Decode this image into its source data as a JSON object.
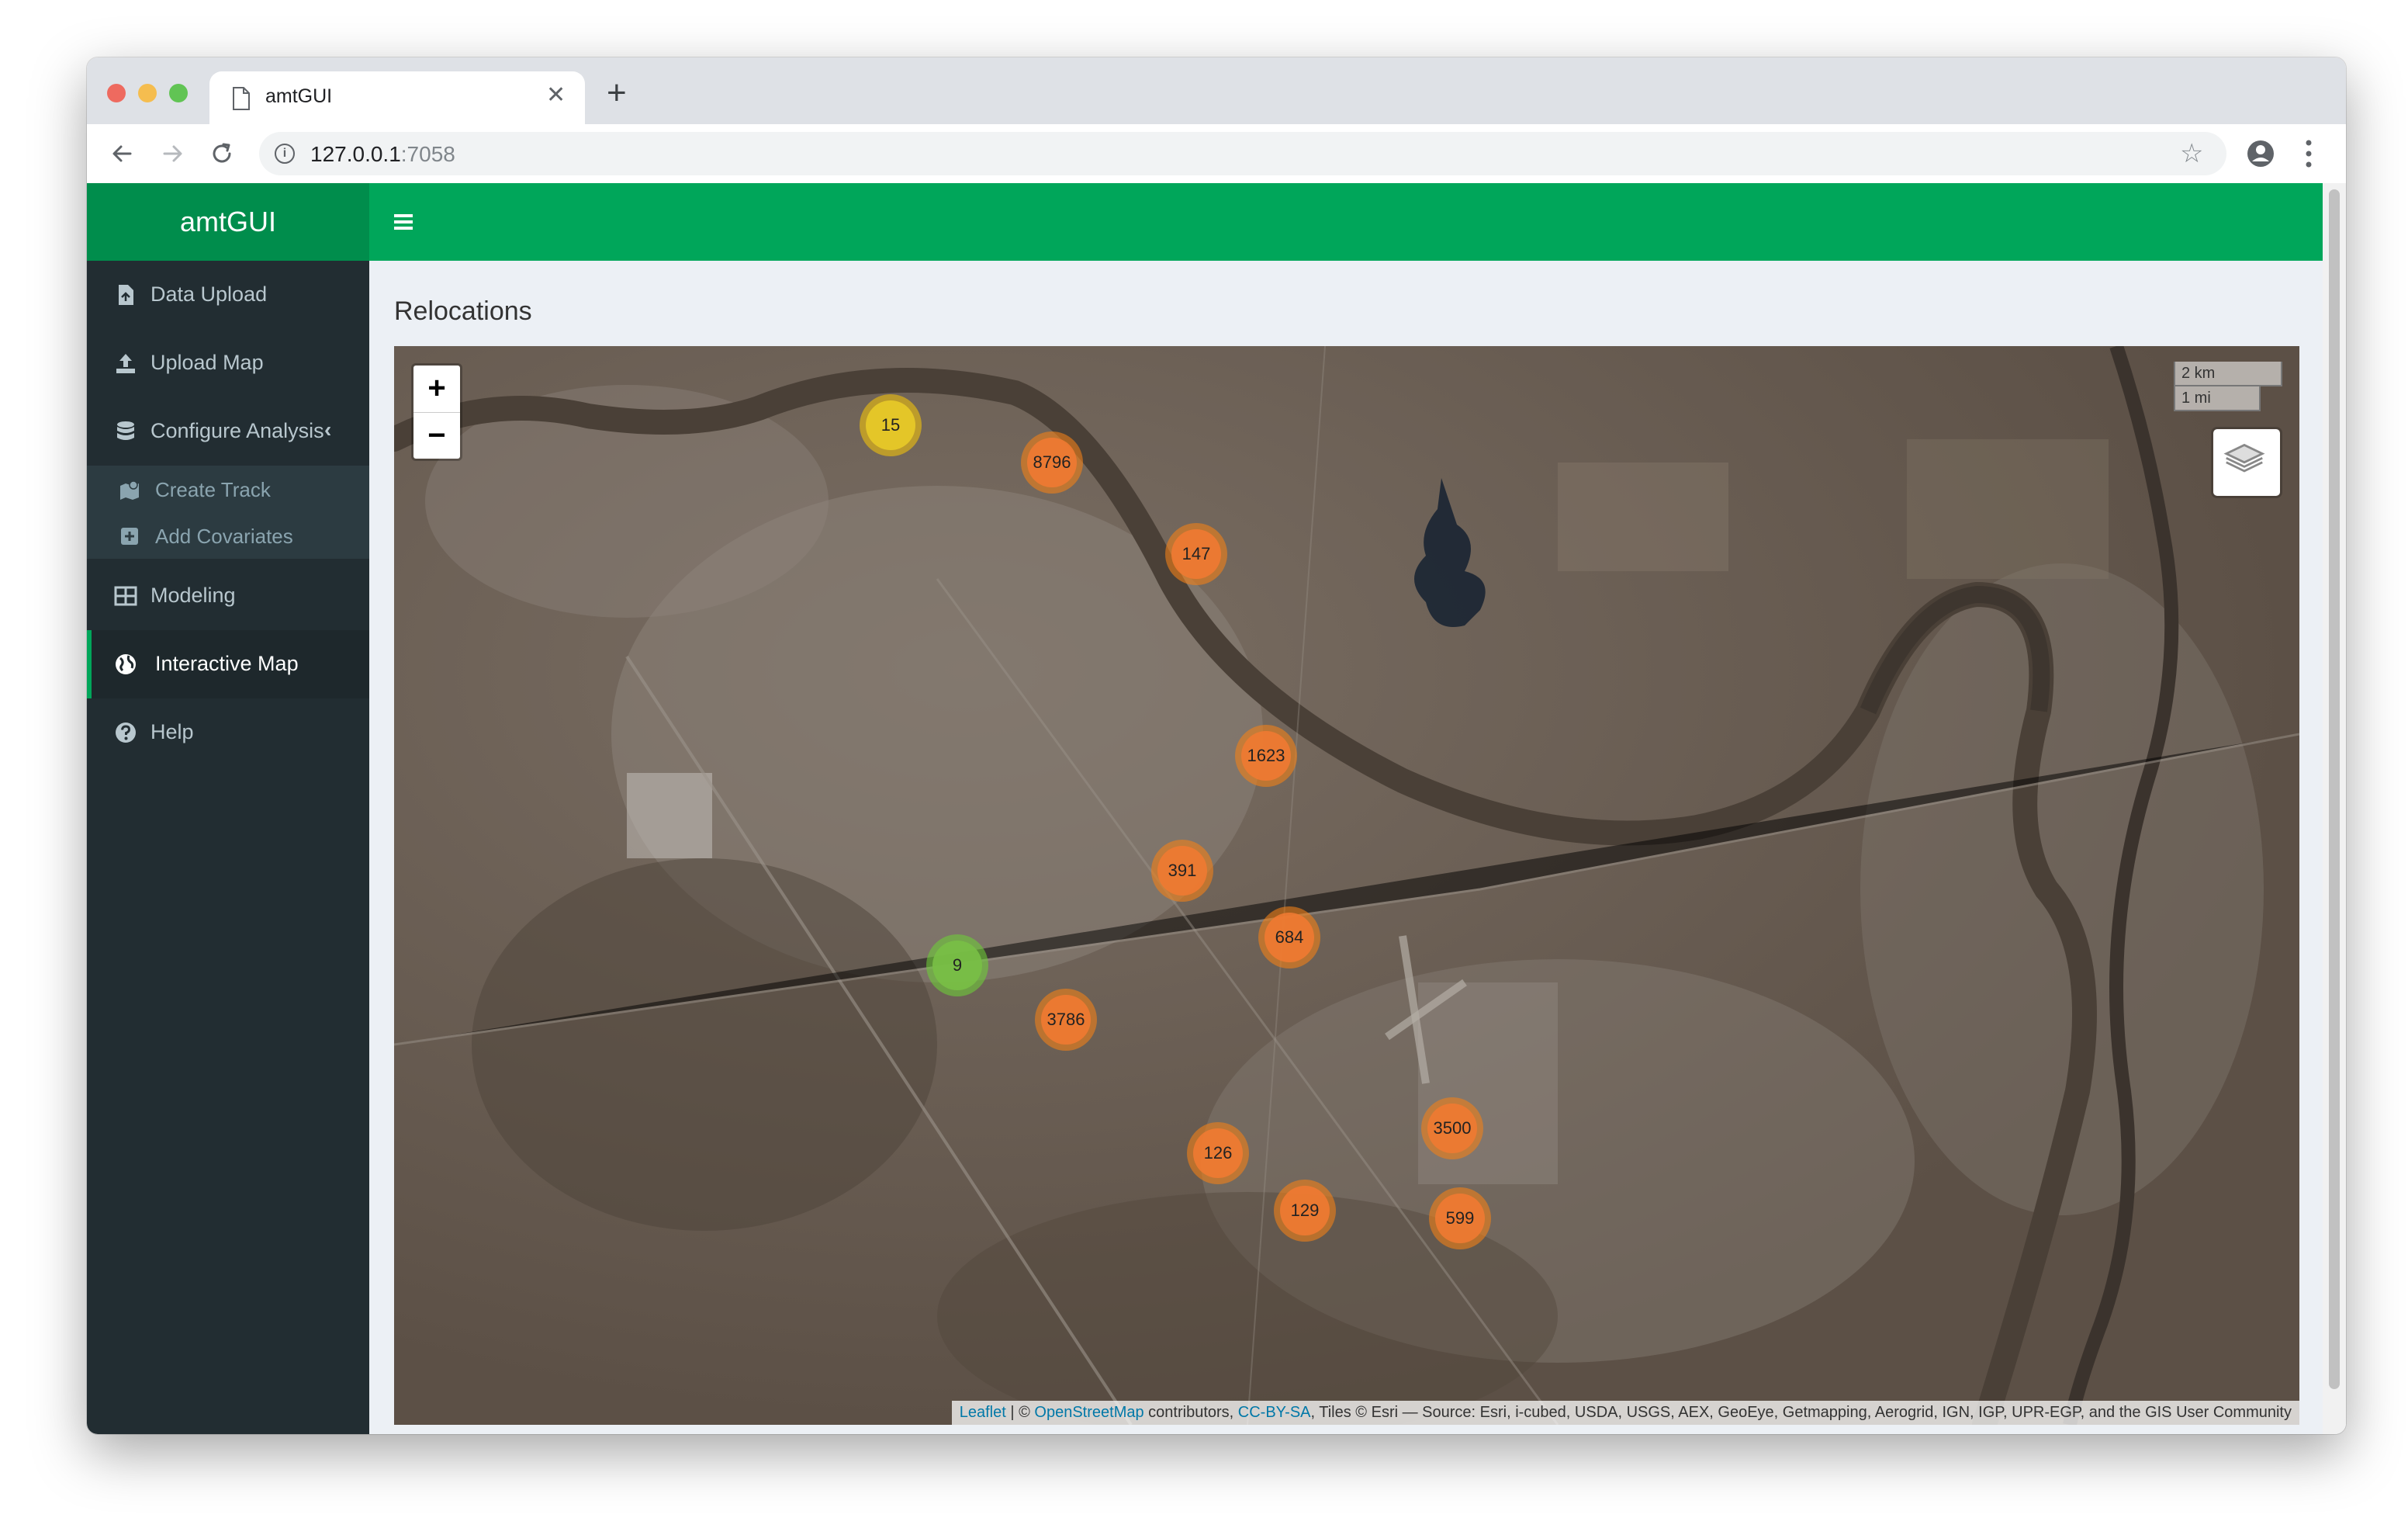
{
  "browser": {
    "tab_title": "amtGUI",
    "url_host": "127.0.0.1",
    "url_port": ":7058"
  },
  "app": {
    "logo": "amtGUI",
    "accent_color": "#00a65a",
    "sidebar": {
      "items": [
        {
          "label": "Data Upload",
          "icon": "file-upload-icon"
        },
        {
          "label": "Upload Map",
          "icon": "upload-icon"
        },
        {
          "label": "Configure Analysis",
          "icon": "database-icon",
          "expanded": true
        },
        {
          "label": "Modeling",
          "icon": "table-icon"
        },
        {
          "label": "Interactive Map",
          "icon": "globe-icon",
          "active": true
        },
        {
          "label": "Help",
          "icon": "question-circle-icon"
        }
      ],
      "subitems": [
        {
          "label": "Create Track",
          "icon": "map-marker-icon"
        },
        {
          "label": "Add Covariates",
          "icon": "plus-square-icon"
        }
      ]
    },
    "page_title": "Relocations",
    "map": {
      "zoom_in": "+",
      "zoom_out": "−",
      "scale_km": "2 km",
      "scale_mi": "1 mi",
      "clusters": [
        {
          "count": "15",
          "color": "yellow"
        },
        {
          "count": "8796",
          "color": "orange"
        },
        {
          "count": "147",
          "color": "orange"
        },
        {
          "count": "1623",
          "color": "orange"
        },
        {
          "count": "391",
          "color": "orange"
        },
        {
          "count": "684",
          "color": "orange"
        },
        {
          "count": "9",
          "color": "green"
        },
        {
          "count": "3786",
          "color": "orange"
        },
        {
          "count": "3500",
          "color": "orange"
        },
        {
          "count": "126",
          "color": "orange"
        },
        {
          "count": "129",
          "color": "orange"
        },
        {
          "count": "599",
          "color": "orange"
        }
      ],
      "attribution": {
        "leaflet": "Leaflet",
        "sep": " | © ",
        "osm": "OpenStreetMap",
        "contrib": " contributors, ",
        "license": "CC-BY-SA",
        "tiles": ", Tiles © Esri — Source: Esri, i-cubed, USDA, USGS, AEX, GeoEye, Getmapping, Aerogrid, IGN, IGP, UPR-EGP, and the GIS User Community"
      }
    }
  }
}
